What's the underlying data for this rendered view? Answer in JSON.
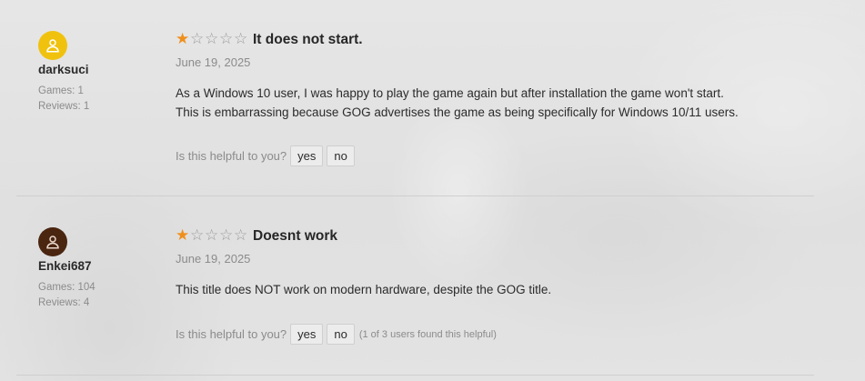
{
  "reviews": [
    {
      "username": "darksuci",
      "avatar_color": "#f0c20e",
      "avatar_icon": "user-icon",
      "games": "Games: 1",
      "reviews_count": "Reviews: 1",
      "rating": 1,
      "rating_max": 5,
      "title": "It does not start.",
      "date": "June 19, 2025",
      "body": [
        "As a Windows 10 user, I was happy to play the game again but after installation the game won't start.",
        "This is embarrassing because GOG advertises the game as being specifically for Windows 10/11 users."
      ],
      "helpful_prompt": "Is this helpful to you?",
      "yes_label": "yes",
      "no_label": "no",
      "helpful_count": ""
    },
    {
      "username": "Enkei687",
      "avatar_color": "#4a2510",
      "avatar_icon": "user-icon",
      "games": "Games: 104",
      "reviews_count": "Reviews: 4",
      "rating": 1,
      "rating_max": 5,
      "title": "Doesnt work",
      "date": "June 19, 2025",
      "body": [
        "This title does NOT work on modern hardware, despite the GOG title."
      ],
      "helpful_prompt": "Is this helpful to you?",
      "yes_label": "yes",
      "no_label": "no",
      "helpful_count": "(1 of 3 users found this helpful)"
    }
  ],
  "colors": {
    "star_filled": "#ef8f1c",
    "star_empty": "#9a9a9a"
  }
}
